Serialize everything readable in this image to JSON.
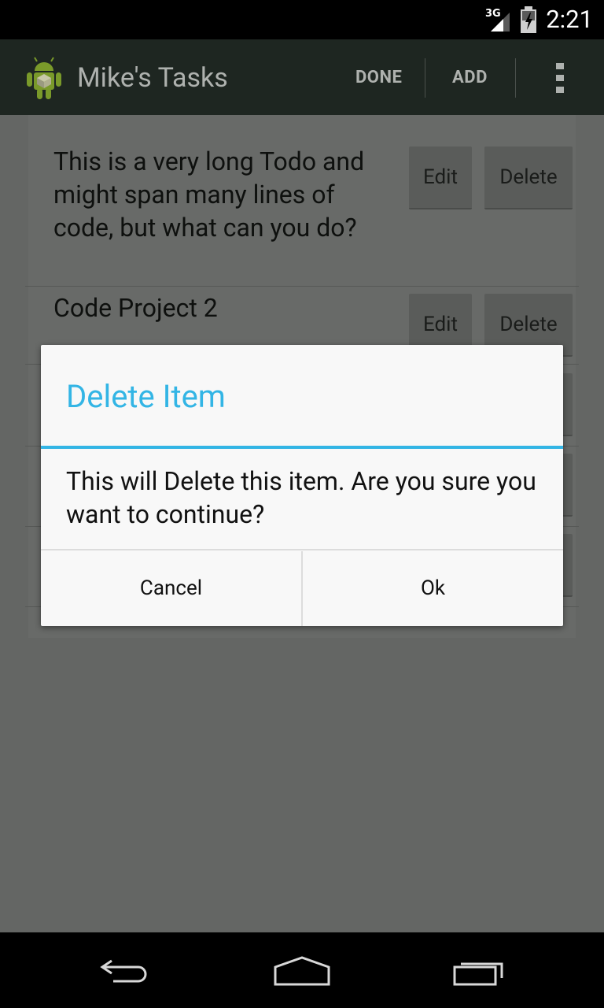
{
  "status_bar": {
    "network": "3G",
    "time": "2:21"
  },
  "action_bar": {
    "title": "Mike's Tasks",
    "done_label": "DONE",
    "add_label": "ADD"
  },
  "todos": [
    {
      "text": "This is a very long Todo and might span many lines of code, but what can you do?",
      "edit_label": "Edit",
      "delete_label": "Delete"
    },
    {
      "text": "Code Project 2",
      "edit_label": "Edit",
      "delete_label": "Delete"
    }
  ],
  "dialog": {
    "title": "Delete Item",
    "message": "This will Delete this item. Are you sure you want to continue?",
    "cancel_label": "Cancel",
    "ok_label": "Ok"
  },
  "colors": {
    "accent": "#33b5e5",
    "action_bar": "#1e2621",
    "dim_background": "#646664"
  },
  "icons": {
    "app": "android-icon",
    "overflow": "overflow-menu-icon",
    "back": "back-icon",
    "home": "home-icon",
    "recents": "recents-icon"
  }
}
